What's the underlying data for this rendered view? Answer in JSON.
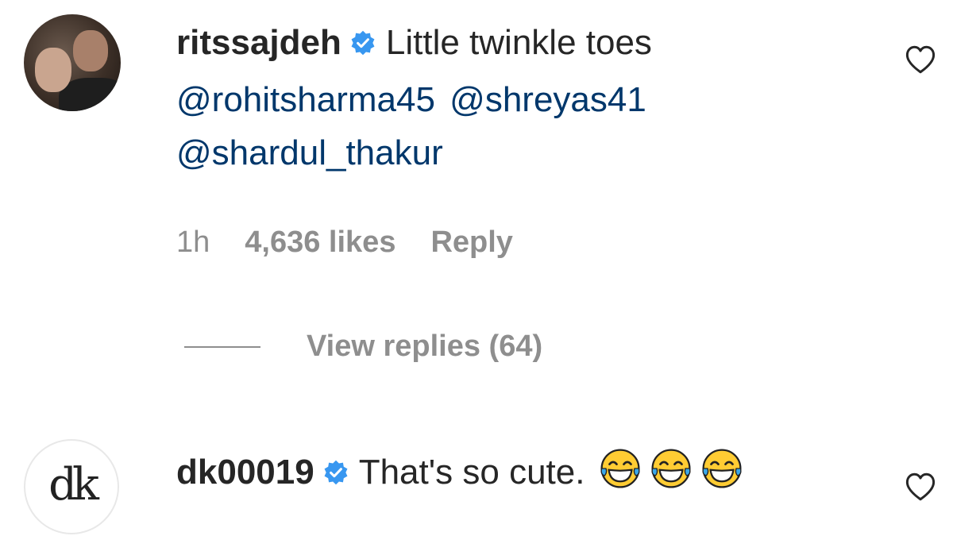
{
  "comments": [
    {
      "username": "ritssajdeh",
      "text": "Little twinkle toes",
      "mentions_line1": [
        "@rohitsharma45",
        "@shreyas41"
      ],
      "mentions_line2": "@shardul_thakur",
      "time": "1h",
      "likes": "4,636 likes",
      "reply_label": "Reply",
      "view_replies": "View replies (64)",
      "verified_icon": "verified-badge-icon",
      "like_icon": "heart-outline-icon"
    },
    {
      "username": "dk00019",
      "avatar_text": "dk",
      "text": "That's so cute.",
      "emoji_icon": "face-with-tears-of-joy-icon",
      "emoji_count": 3,
      "verified_icon": "verified-badge-icon",
      "like_icon": "heart-outline-icon"
    }
  ],
  "colors": {
    "text": "#262626",
    "secondary": "#8e8e8e",
    "mention": "#00376b",
    "verified": "#3897f0",
    "emoji": "#ffcc33"
  }
}
